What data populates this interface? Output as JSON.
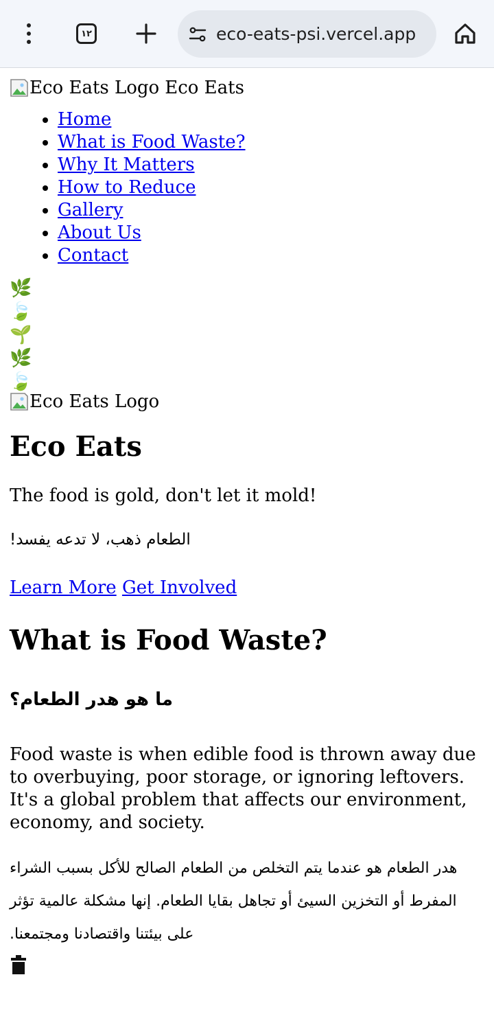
{
  "browser": {
    "tab_count": "١٢",
    "url": "eco-eats-psi.vercel.app"
  },
  "header": {
    "logo_alt": "Eco Eats Logo",
    "brand": "Eco Eats"
  },
  "nav": {
    "items": [
      {
        "label": "Home"
      },
      {
        "label": "What is Food Waste?"
      },
      {
        "label": "Why It Matters"
      },
      {
        "label": "How to Reduce"
      },
      {
        "label": "Gallery"
      },
      {
        "label": "About Us"
      },
      {
        "label": "Contact"
      }
    ]
  },
  "decor": {
    "leaves": [
      "🌿",
      "🍃",
      "🌱",
      "🌿",
      "🍃"
    ]
  },
  "hero": {
    "logo_alt": "Eco Eats Logo",
    "title": "Eco Eats",
    "tagline": "The food is gold, don't let it mold!",
    "tagline_ar": "الطعام ذهب، لا تدعه يفسد!",
    "learn_more": "Learn More",
    "get_involved": "Get Involved"
  },
  "food_waste": {
    "heading": "What is Food Waste?",
    "heading_ar": "ما هو هدر الطعام؟",
    "body": "Food waste is when edible food is thrown away due to overbuying, poor storage, or ignoring leftovers. It's a global problem that affects our environment, economy, and society.",
    "body_ar": "هدر الطعام هو عندما يتم التخلص من الطعام الصالح للأكل بسبب الشراء المفرط أو التخزين السيئ أو تجاهل بقايا الطعام. إنها مشكلة عالمية تؤثر على بيئتنا واقتصادنا ومجتمعنا."
  }
}
